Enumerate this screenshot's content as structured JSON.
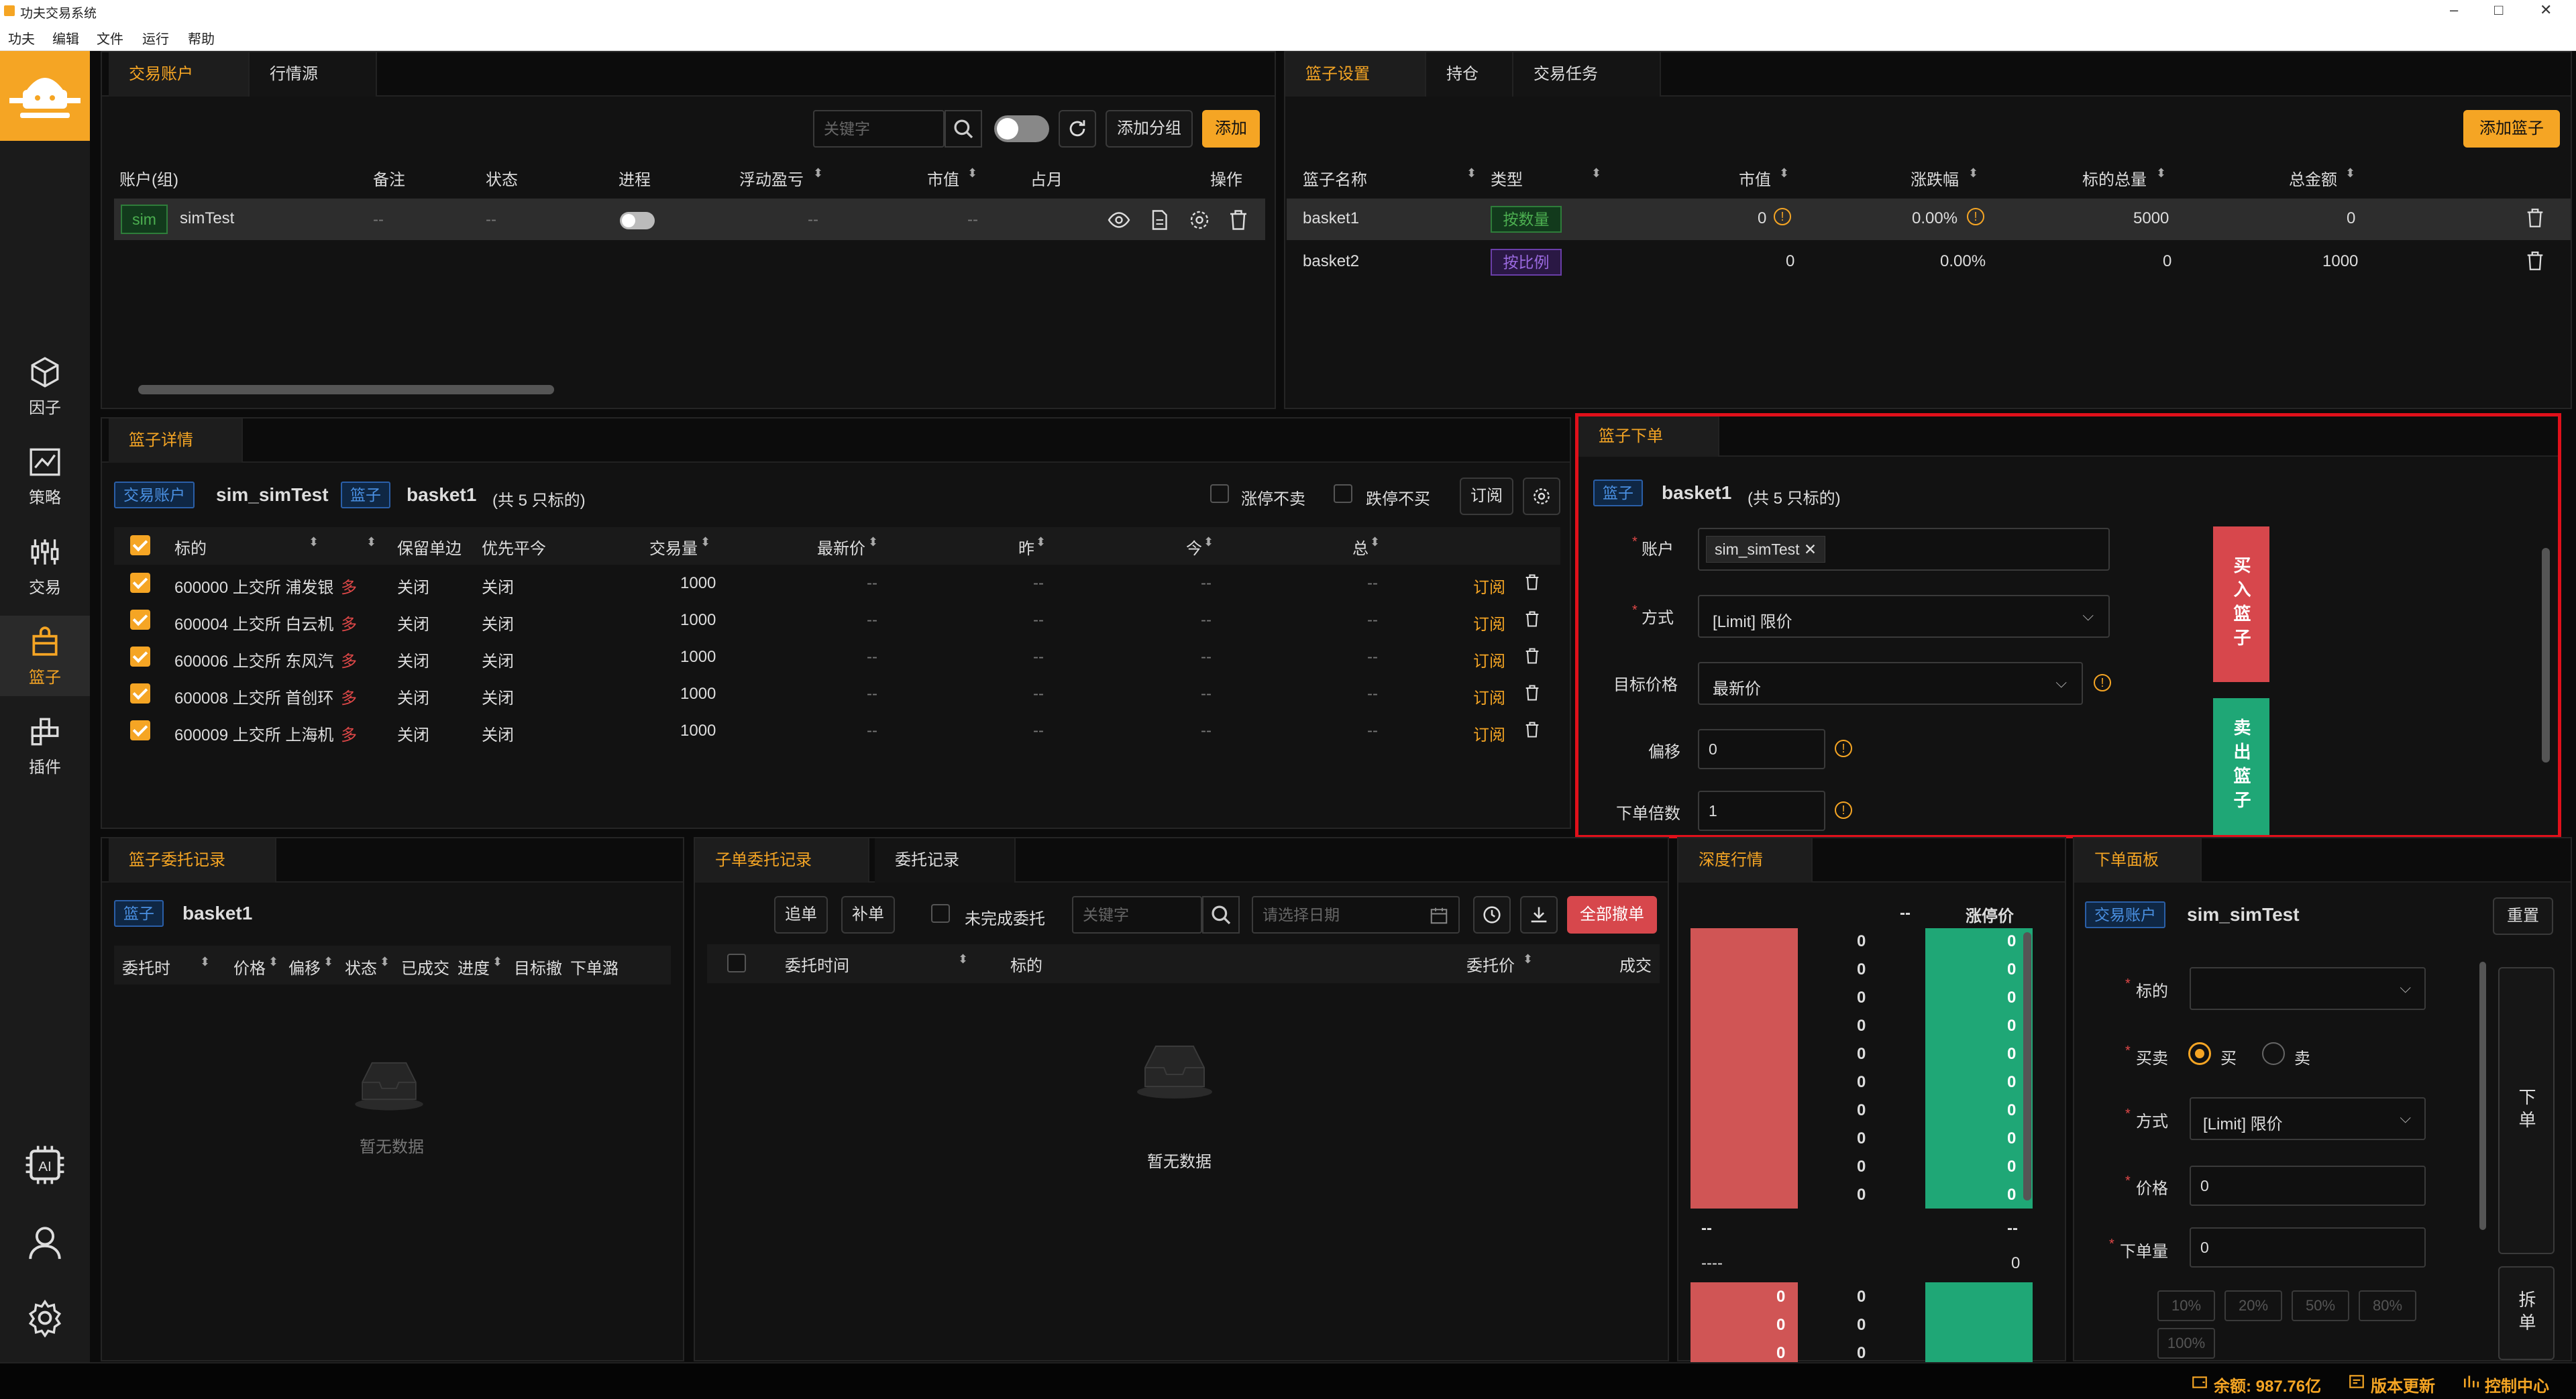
{
  "window": {
    "title": "功夫交易系统",
    "min": "–",
    "max": "□",
    "close": "✕"
  },
  "menu": [
    "功夫",
    "编辑",
    "文件",
    "运行",
    "帮助"
  ],
  "sidebar": {
    "items": [
      {
        "label": "因子"
      },
      {
        "label": "策略"
      },
      {
        "label": "交易"
      },
      {
        "label": "篮子"
      },
      {
        "label": "插件"
      }
    ],
    "active": "篮子"
  },
  "accounts": {
    "tabs": [
      "交易账户",
      "行情源"
    ],
    "search_placeholder": "关键字",
    "add_group": "添加分组",
    "add": "添加",
    "headers": [
      "账户(组)",
      "备注",
      "状态",
      "进程",
      "浮动盈亏",
      "市值",
      "占月",
      "操作"
    ],
    "row": {
      "tag": "sim",
      "name": "simTest",
      "note": "--",
      "status": "--",
      "pnl": "--",
      "mv": "--"
    }
  },
  "basket_settings": {
    "tabs": [
      "篮子设置",
      "持仓",
      "交易任务"
    ],
    "add": "添加篮子",
    "headers": [
      "篮子名称",
      "类型",
      "市值",
      "涨跌幅",
      "标的总量",
      "总金额"
    ],
    "rows": [
      {
        "name": "basket1",
        "type": "按数量",
        "mv": "0",
        "chg": "0.00%",
        "qty": "5000",
        "amt": "0"
      },
      {
        "name": "basket2",
        "type": "按比例",
        "mv": "0",
        "chg": "0.00%",
        "qty": "0",
        "amt": "1000"
      }
    ]
  },
  "basket_detail": {
    "tab": "篮子详情",
    "account_tag": "交易账户",
    "account": "sim_simTest",
    "basket_tag": "篮子",
    "basket": "basket1",
    "count": "(共 5 只标的)",
    "opt1": "涨停不卖",
    "opt2": "跌停不买",
    "subscribe": "订阅",
    "headers": [
      "标的",
      "",
      "保留单边",
      "优先平今",
      "交易量",
      "最新价",
      "昨",
      "今",
      "总"
    ],
    "rows": [
      {
        "sym": "600000 上交所 浦发银",
        "dir": "多",
        "a": "关闭",
        "b": "关闭",
        "vol": "1000",
        "p": "--",
        "y": "--",
        "t": "--",
        "s": "--",
        "act": "订阅"
      },
      {
        "sym": "600004 上交所 白云机",
        "dir": "多",
        "a": "关闭",
        "b": "关闭",
        "vol": "1000",
        "p": "--",
        "y": "--",
        "t": "--",
        "s": "--",
        "act": "订阅"
      },
      {
        "sym": "600006 上交所 东风汽",
        "dir": "多",
        "a": "关闭",
        "b": "关闭",
        "vol": "1000",
        "p": "--",
        "y": "--",
        "t": "--",
        "s": "--",
        "act": "订阅"
      },
      {
        "sym": "600008 上交所 首创环",
        "dir": "多",
        "a": "关闭",
        "b": "关闭",
        "vol": "1000",
        "p": "--",
        "y": "--",
        "t": "--",
        "s": "--",
        "act": "订阅"
      },
      {
        "sym": "600009 上交所 上海机",
        "dir": "多",
        "a": "关闭",
        "b": "关闭",
        "vol": "1000",
        "p": "--",
        "y": "--",
        "t": "--",
        "s": "--",
        "act": "订阅"
      }
    ]
  },
  "basket_order": {
    "tab": "篮子下单",
    "basket_tag": "篮子",
    "basket": "basket1",
    "count": "(共 5 只标的)",
    "account_label": "账户",
    "account_value": "sim_simTest",
    "method_label": "方式",
    "method_value": "[Limit] 限价",
    "target_label": "目标价格",
    "target_value": "最新价",
    "offset_label": "偏移",
    "offset_value": "0",
    "mult_label": "下单倍数",
    "mult_value": "1",
    "buy": "买入篮子",
    "sell": "卖出篮子"
  },
  "basket_orders": {
    "tab": "篮子委托记录",
    "basket_tag": "篮子",
    "basket": "basket1",
    "headers": [
      "委托时",
      "价格",
      "偏移",
      "状态",
      "已成交",
      "进度",
      "目标撤",
      "下单潞"
    ],
    "empty": "暂无数据"
  },
  "child_orders": {
    "tabs": [
      "子单委托记录",
      "委托记录"
    ],
    "chase": "追单",
    "fill": "补单",
    "unfinished": "未完成委托",
    "search_placeholder": "关键字",
    "date_placeholder": "请选择日期",
    "cancel_all": "全部撤单",
    "headers": [
      "委托时间",
      "标的",
      "委托价",
      "成交"
    ],
    "empty": "暂无数据"
  },
  "depth": {
    "tab": "深度行情",
    "dash": "--",
    "limit_up": "涨停价",
    "ask_vals": [
      "0",
      "0",
      "0",
      "0",
      "0",
      "0",
      "0",
      "0",
      "0",
      "0"
    ],
    "mid_left": "--",
    "mid_right": "--",
    "mid2_left": "----",
    "mid2_right": "0",
    "bid_vals": [
      "0",
      "0",
      "0"
    ]
  },
  "order_panel": {
    "tab": "下单面板",
    "account_tag": "交易账户",
    "account": "sim_simTest",
    "reset": "重置",
    "symbol_label": "标的",
    "side_label": "买卖",
    "buy": "买",
    "sell": "卖",
    "method_label": "方式",
    "method_value": "[Limit] 限价",
    "price_label": "价格",
    "price_value": "0",
    "qty_label": "下单量",
    "qty_value": "0",
    "pcts": [
      "10%",
      "20%",
      "50%",
      "80%",
      "100%"
    ],
    "submit": "下单",
    "split": "拆单"
  },
  "status": {
    "balance": "余额: 987.76亿",
    "update": "版本更新",
    "control": "控制中心"
  },
  "colors": {
    "accent": "#f5a524",
    "buy": "#d7474c",
    "sell": "#1fa776",
    "blue": "#2a5fa8",
    "highlight": "#e0101a"
  }
}
